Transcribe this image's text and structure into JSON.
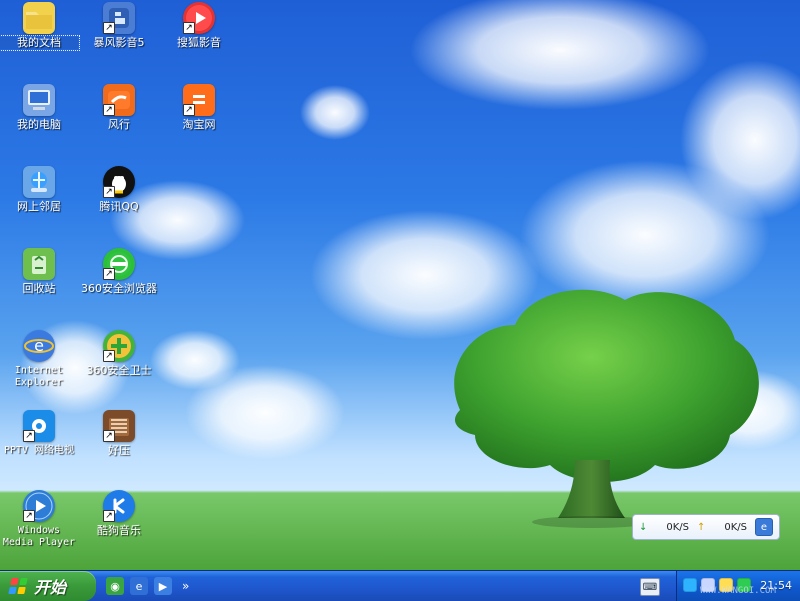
{
  "desktop": {
    "icons": [
      {
        "name": "我的文档",
        "icon": "folder-documents-icon",
        "shortcut": false,
        "selected": true,
        "color": "#f2d24c"
      },
      {
        "name": "暴风影音5",
        "icon": "storm-player-icon",
        "shortcut": true,
        "selected": false,
        "color": "#4c7dd4"
      },
      {
        "name": "搜狐影音",
        "icon": "sohu-video-icon",
        "shortcut": true,
        "selected": false,
        "color": "#e43333"
      },
      {
        "name": "我的电脑",
        "icon": "my-computer-icon",
        "shortcut": false,
        "selected": false,
        "color": "#7aa6e6"
      },
      {
        "name": "风行",
        "icon": "fengxing-icon",
        "shortcut": true,
        "selected": false,
        "color": "#f06b1c"
      },
      {
        "name": "淘宝网",
        "icon": "taobao-icon",
        "shortcut": true,
        "selected": false,
        "color": "#ff6d1a"
      },
      {
        "name": "网上邻居",
        "icon": "network-places-icon",
        "shortcut": false,
        "selected": false,
        "color": "#6aa7e8"
      },
      {
        "name": "腾讯QQ",
        "icon": "qq-penguin-icon",
        "shortcut": true,
        "selected": false,
        "color": "#111111"
      },
      {
        "name": "回收站",
        "icon": "recycle-bin-icon",
        "shortcut": false,
        "selected": false,
        "color": "#6fbf4f"
      },
      {
        "name": "360安全浏览器",
        "icon": "360-browser-icon",
        "shortcut": true,
        "selected": false,
        "color": "#2bbf3a"
      },
      {
        "name": "Internet Explorer",
        "icon": "internet-explorer-icon",
        "shortcut": false,
        "selected": false,
        "color": "#3b7be0"
      },
      {
        "name": "360安全卫士",
        "icon": "360-security-icon",
        "shortcut": true,
        "selected": false,
        "color": "#43b43b"
      },
      {
        "name": "PPTV 网络电视",
        "icon": "pptv-icon",
        "shortcut": true,
        "selected": false,
        "color": "#1b8ce8"
      },
      {
        "name": "好压",
        "icon": "haozip-icon",
        "shortcut": true,
        "selected": false,
        "color": "#7b4b2a"
      },
      {
        "name": "Windows Media Player",
        "icon": "windows-media-player-icon",
        "shortcut": true,
        "selected": false,
        "color": "#2d7dd6"
      },
      {
        "name": "酷狗音乐",
        "icon": "kugou-music-icon",
        "shortcut": true,
        "selected": false,
        "color": "#1f7be8"
      }
    ]
  },
  "speed_widget": {
    "down": "0K/S",
    "up": "0K/S",
    "down_arrow": "↓",
    "up_arrow": "↑",
    "ie_badge": "e"
  },
  "taskbar": {
    "start_label": "开始",
    "quick_launch": [
      {
        "icon": "show-desktop-icon",
        "glyph": "◉",
        "color": "#3aa540"
      },
      {
        "icon": "internet-explorer-icon",
        "glyph": "e",
        "color": "#2f6fd6"
      },
      {
        "icon": "media-player-icon",
        "glyph": "▶",
        "color": "#3a7fe1"
      }
    ],
    "more_chevron": "»",
    "keyboard_glyph": "⌨",
    "tray_icons": [
      {
        "icon": "security-shield-icon",
        "color": "#2db3ff"
      },
      {
        "icon": "network-icon",
        "color": "#c9d6ff"
      },
      {
        "icon": "volume-icon",
        "color": "#ffdd55"
      },
      {
        "icon": "update-icon",
        "color": "#2fcc52"
      }
    ],
    "clock": "21:54"
  },
  "watermark": "WWW.WANGOI.COM"
}
